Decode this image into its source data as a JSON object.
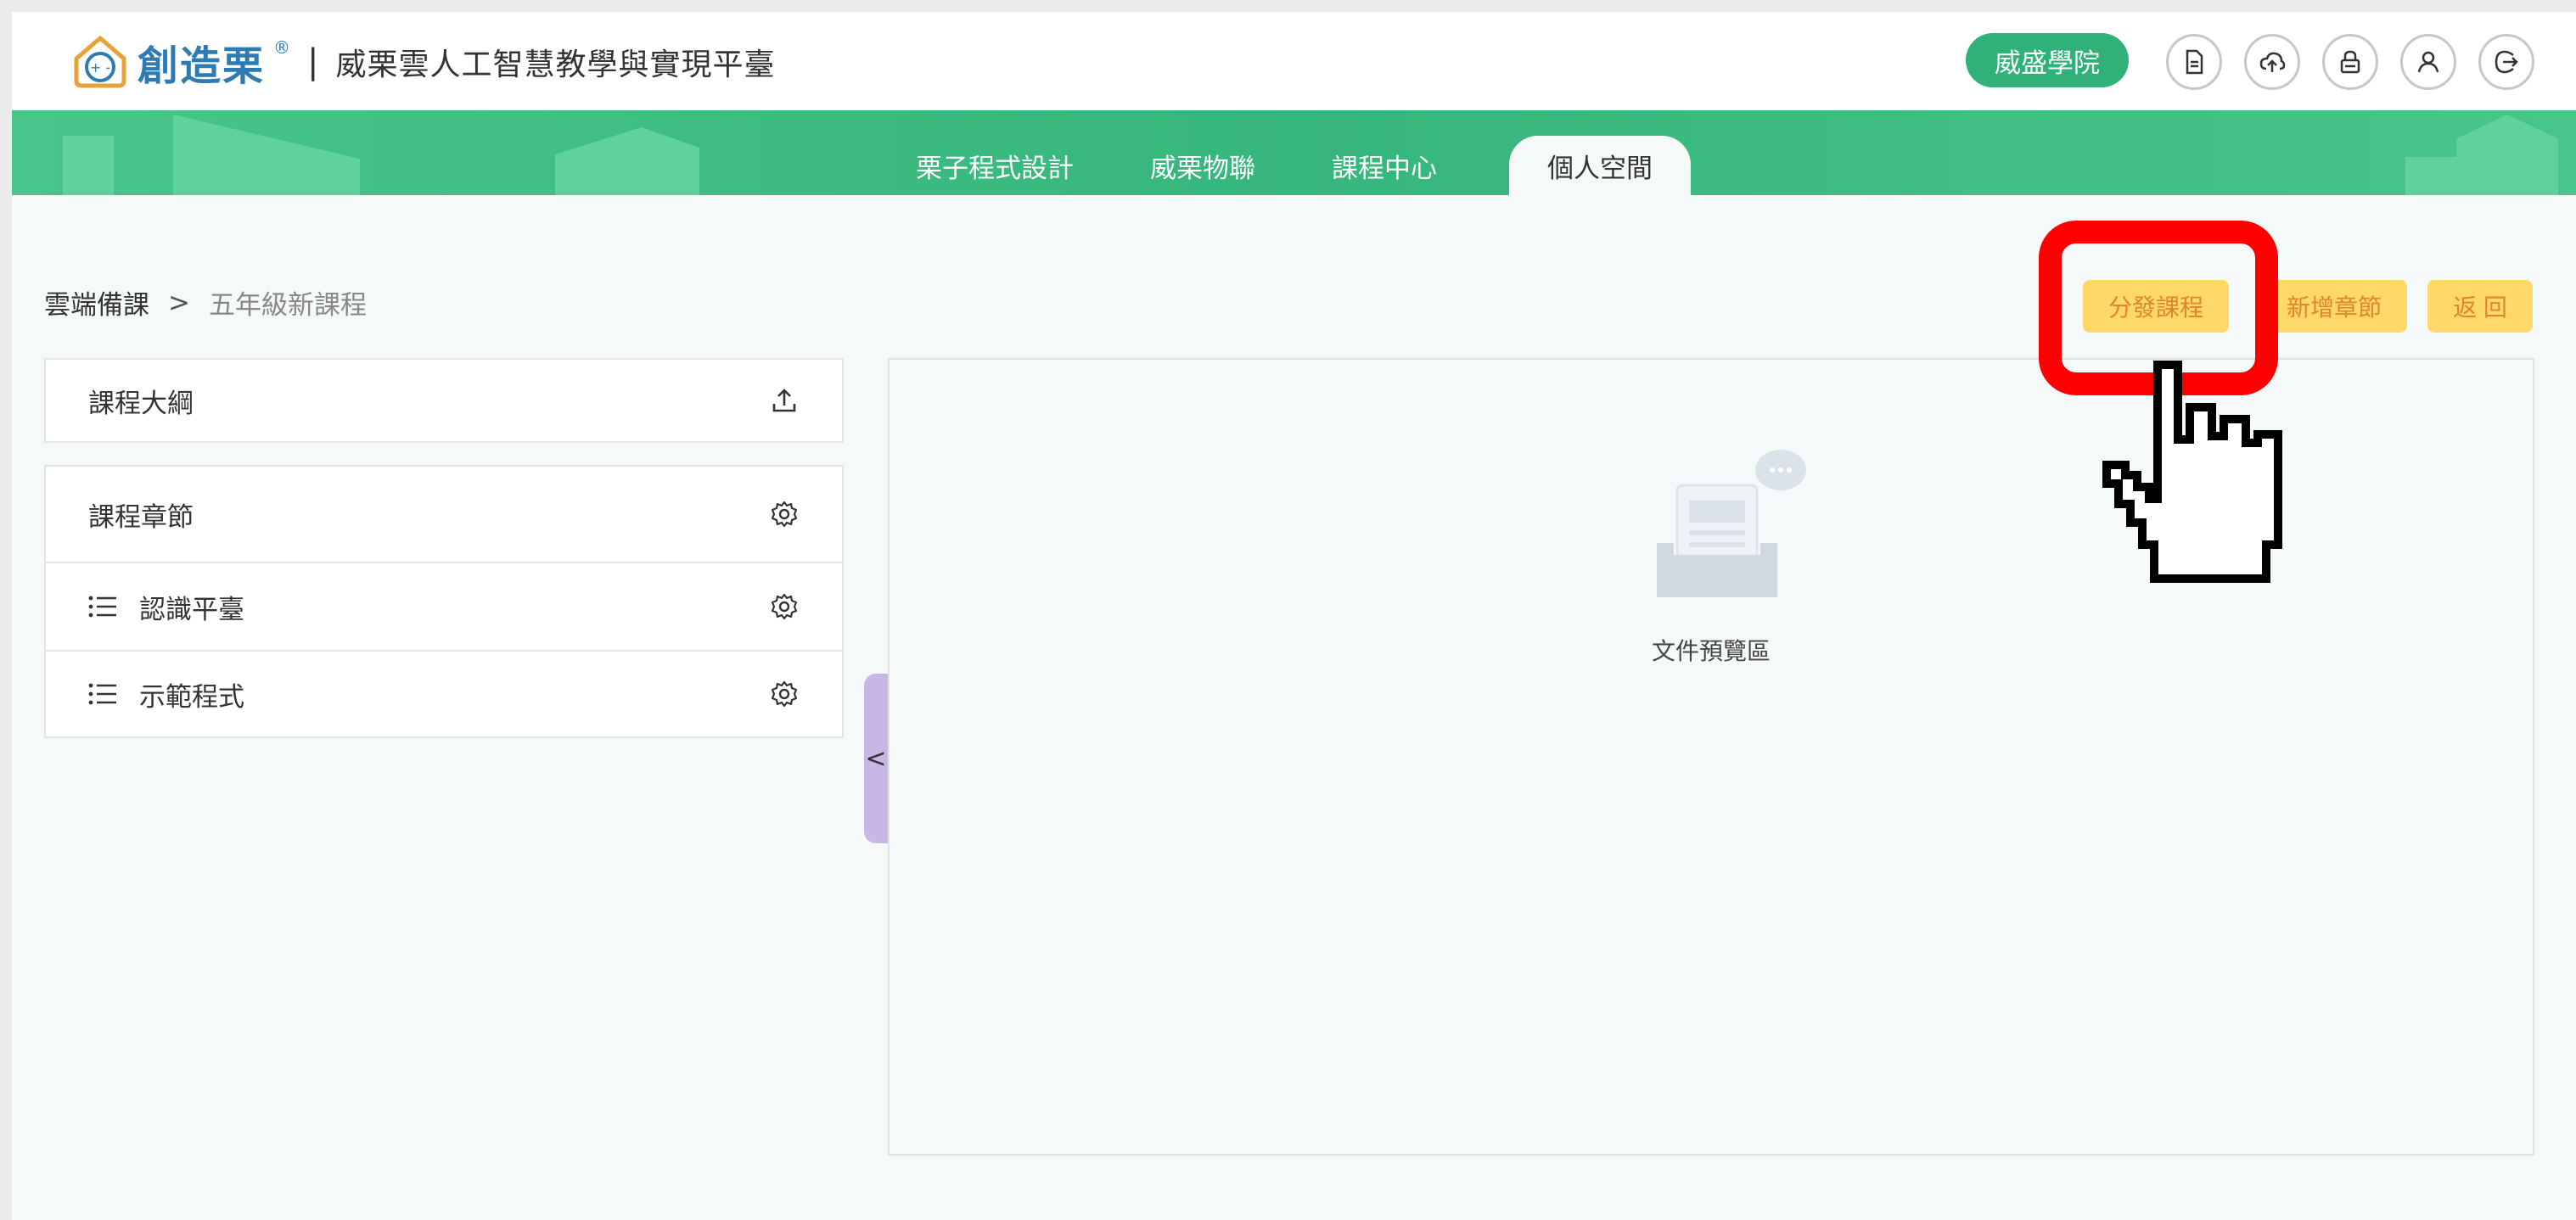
{
  "header": {
    "logo_text": "創造栗",
    "logo_reg": "®",
    "separator": "|",
    "platform_name": "威栗雲人工智慧教學與實現平臺",
    "school_button": "威盛學院",
    "icons": [
      "document-icon",
      "cloud-upload-icon",
      "lock-icon",
      "user-icon",
      "logout-icon"
    ]
  },
  "nav": {
    "tabs": [
      {
        "label": "栗子程式設計"
      },
      {
        "label": "威栗物聯"
      },
      {
        "label": "課程中心"
      },
      {
        "label": "個人空間",
        "active": true
      }
    ]
  },
  "breadcrumb": {
    "root": "雲端備課",
    "separator": ">",
    "current": "五年級新課程"
  },
  "actions": {
    "distribute": "分發課程",
    "add_chapter": "新增章節",
    "back": "返 回"
  },
  "sidebar": {
    "outline_label": "課程大綱",
    "chapters_label": "課程章節",
    "chapters": [
      {
        "label": "認識平臺"
      },
      {
        "label": "示範程式"
      }
    ],
    "collapse_glyph": "<"
  },
  "preview": {
    "empty_text": "文件預覽區"
  },
  "colors": {
    "brand_green": "#2fb178",
    "accent_yellow": "#ffd86a",
    "accent_orange": "#e0862a",
    "highlight_red": "#ff0000",
    "logo_blue": "#2e7bb4"
  }
}
